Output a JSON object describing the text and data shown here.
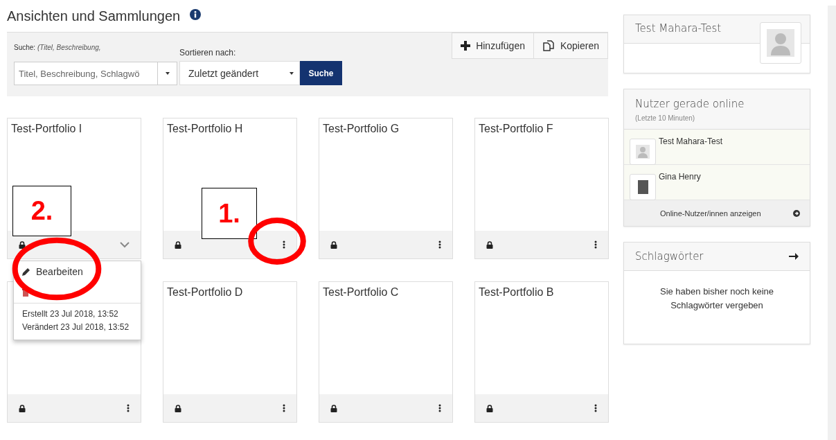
{
  "page_title": "Ansichten und Sammlungen",
  "filter": {
    "search_label": "Suche:",
    "search_hint": "(Titel, Beschreibung,",
    "search_placeholder": "Titel, Beschreibung, Schlagwö",
    "sort_label": "Sortieren nach:",
    "sort_value": "Zuletzt geändert",
    "search_button": "Suche"
  },
  "actions": [
    {
      "label": "Hinzufügen",
      "kind": "add"
    },
    {
      "label": "Kopieren",
      "kind": "copy"
    }
  ],
  "cards": [
    {
      "title": "Test-Portfolio I",
      "menu_open": true
    },
    {
      "title": "Test-Portfolio H",
      "menu_open": false
    },
    {
      "title": "Test-Portfolio G",
      "menu_open": false
    },
    {
      "title": "Test-Portfolio F",
      "menu_open": false
    },
    {
      "menu_open": false
    },
    {
      "title": "Test-Portfolio D",
      "menu_open": false
    },
    {
      "title": "Test-Portfolio C",
      "menu_open": false
    },
    {
      "title": "Test-Portfolio B",
      "menu_open": false
    }
  ],
  "card_menu": {
    "items": [
      {
        "kind": "edit",
        "label": "Bearbeiten"
      },
      {
        "kind": "delete"
      }
    ],
    "created": "Erstellt 23 Jul 2018, 13:52",
    "modified": "Verändert 23 Jul 2018, 13:52"
  },
  "profile": {
    "name": "Test Mahara-Test"
  },
  "online": {
    "title": "Nutzer gerade online",
    "subtitle": "(Letzte 10 Minuten)",
    "users": [
      {
        "name": "Test Mahara-Test",
        "kind": "default"
      },
      {
        "name": "Gina Henry",
        "kind": "photo"
      }
    ],
    "link": "Online-Nutzer/innen anzeigen"
  },
  "tags": {
    "title": "Schlagwörter",
    "empty": "Sie haben bisher noch keine Schlagwörter vergeben"
  },
  "annotations": [
    {
      "kind": "label",
      "text": "2."
    },
    {
      "kind": "label",
      "text": "1."
    },
    {
      "kind": "ellipse"
    },
    {
      "kind": "ellipse"
    }
  ]
}
